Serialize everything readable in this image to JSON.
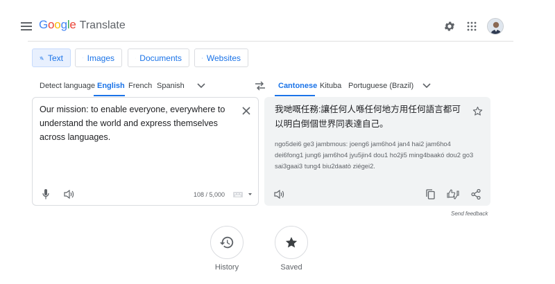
{
  "header": {
    "menu_icon": "hamburger-menu-icon",
    "logo_google": "Google",
    "logo_translate": "Translate",
    "logo_colors": [
      "#4285f4",
      "#ea4335",
      "#fbbc05",
      "#4285f4",
      "#34a853",
      "#ea4335"
    ],
    "settings_icon": "gear-icon",
    "apps_icon": "apps-grid-icon",
    "avatar_icon": "user-avatar"
  },
  "modes": [
    {
      "label": "Text",
      "icon": "translate-icon",
      "active": true
    },
    {
      "label": "Images",
      "icon": "image-icon",
      "active": false
    },
    {
      "label": "Documents",
      "icon": "document-icon",
      "active": false
    },
    {
      "label": "Websites",
      "icon": "website-icon",
      "active": false
    }
  ],
  "source_languages": {
    "items": [
      "Detect language",
      "English",
      "French",
      "Spanish"
    ],
    "selected": "English"
  },
  "target_languages": {
    "items": [
      "Cantonese",
      "Kituba",
      "Portuguese (Brazil)"
    ],
    "selected": "Cantonese"
  },
  "source": {
    "text": "Our mission: to enable everyone, everywhere to understand the world and express themselves across languages.",
    "char_count": "108 / 5,000"
  },
  "target": {
    "text": "我哋嘅任務:讓任何人喺任何地方用任何語言都可以明白倒個世界同表達自己。",
    "romanization": "ngo5dei6 ge3 jambmous: joeng6 jam6ho4 jan4 hai2 jam6ho4 dei6fong1 jung6 jam6ho4 jyu5jin4 dou1 ho2ji5 ming4baakó dou2 go3 sai3gaai3 tung4 biu2daatò ziégei2."
  },
  "feedback": {
    "label": "Send feedback"
  },
  "bottom_actions": [
    {
      "label": "History",
      "icon": "history-icon"
    },
    {
      "label": "Saved",
      "icon": "star-icon"
    }
  ],
  "colors": {
    "accent": "#1a73e8",
    "panel_bg": "#f1f3f4",
    "border": "#dadce0"
  }
}
